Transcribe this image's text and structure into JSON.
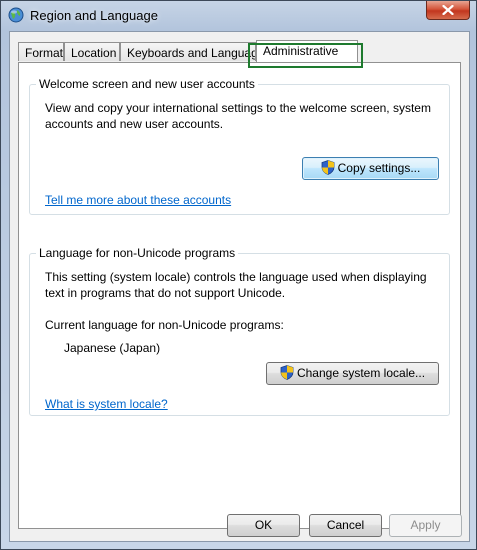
{
  "window": {
    "title": "Region and Language"
  },
  "tabs": [
    {
      "label": "Formats"
    },
    {
      "label": "Location"
    },
    {
      "label": "Keyboards and Languages"
    },
    {
      "label": "Administrative"
    }
  ],
  "welcome": {
    "title": "Welcome screen and new user accounts",
    "description_line1": "View and copy your international settings to the welcome screen, system",
    "description_line2": "accounts and new user accounts.",
    "copy_button": "Copy settings...",
    "link": "Tell me more about these accounts"
  },
  "non_unicode": {
    "title": "Language for non-Unicode programs",
    "description_line1": "This setting (system locale) controls the language used when displaying",
    "description_line2": "text in programs that do not support Unicode.",
    "current_label": "Current language for non-Unicode programs:",
    "current_value": "Japanese (Japan)",
    "change_button": "Change system locale...",
    "link": "What is system locale?"
  },
  "footer": {
    "ok": "OK",
    "cancel": "Cancel",
    "apply": "Apply"
  },
  "icons": {
    "window_icon": "globe-icon",
    "close": "close-icon",
    "uac": "uac-shield-icon"
  }
}
